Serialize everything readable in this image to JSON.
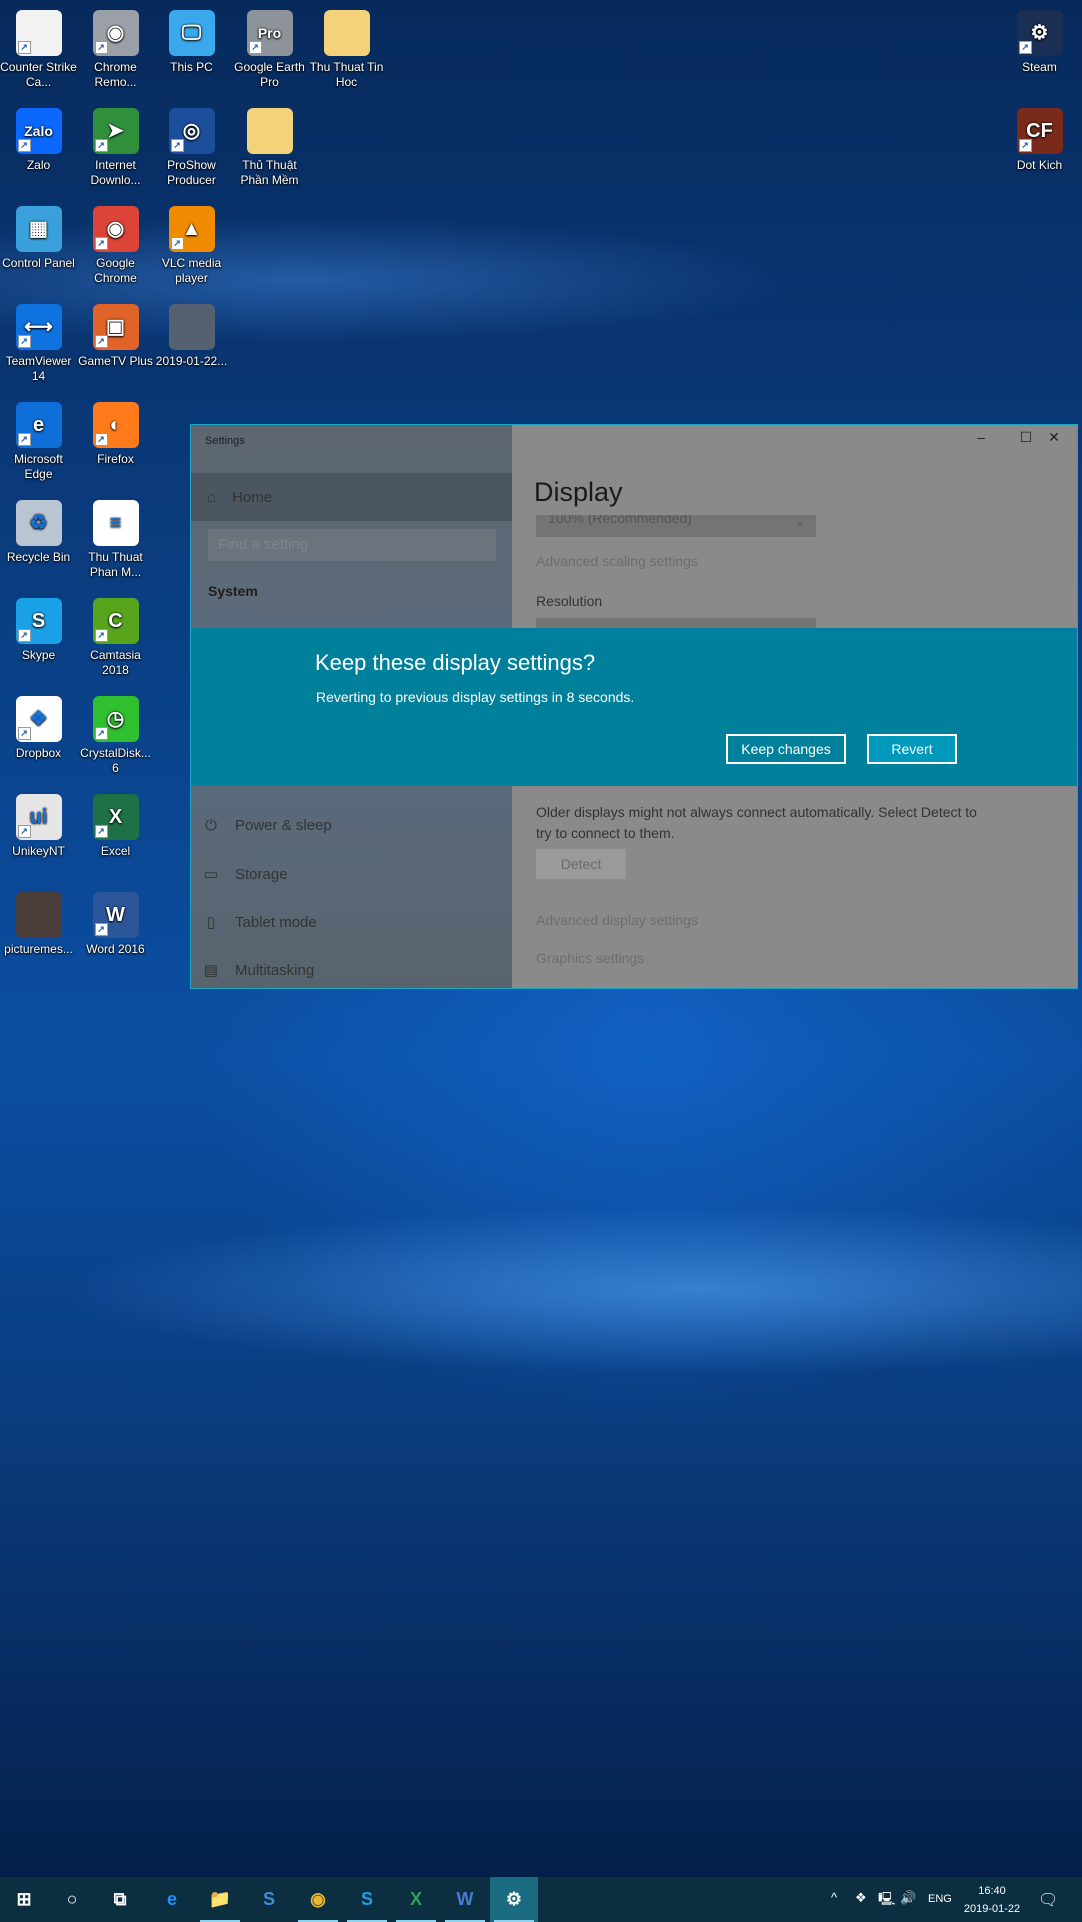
{
  "desktop": {
    "icons": [
      {
        "label": "Counter Strike Ca...",
        "icon": "file-icon",
        "color": "#f2f2f2",
        "glyph": "",
        "shortcut": true
      },
      {
        "label": "Zalo",
        "icon": "zalo-icon",
        "color": "#0a68ff",
        "glyph": "Zalo",
        "shortcut": true
      },
      {
        "label": "Control Panel",
        "icon": "control-panel-icon",
        "color": "#3aa0dc",
        "glyph": "▦",
        "shortcut": false
      },
      {
        "label": "TeamViewer 14",
        "icon": "teamviewer-icon",
        "color": "#0e72e0",
        "glyph": "⟷",
        "shortcut": true
      },
      {
        "label": "Microsoft Edge",
        "icon": "edge-icon",
        "color": "#0f6fd8",
        "glyph": "e",
        "shortcut": true
      },
      {
        "label": "Recycle Bin",
        "icon": "recycle-bin-icon",
        "color": "#b9c6d2",
        "glyph": "♻",
        "shortcut": false
      },
      {
        "label": "Skype",
        "icon": "skype-icon",
        "color": "#1aa1e8",
        "glyph": "S",
        "shortcut": true
      },
      {
        "label": "Dropbox",
        "icon": "dropbox-icon",
        "color": "#ffffff",
        "glyph": "❖",
        "shortcut": true
      },
      {
        "label": "UnikeyNT",
        "icon": "unikey-icon",
        "color": "#e6e6e6",
        "glyph": "ui",
        "shortcut": true
      },
      {
        "label": "picturemes...",
        "icon": "image-thumbnail-icon",
        "color": "#4a3d3a",
        "glyph": "",
        "shortcut": false
      },
      {
        "label": "Chrome Remo...",
        "icon": "chrome-remote-icon",
        "color": "#9aa0a6",
        "glyph": "◉",
        "shortcut": true
      },
      {
        "label": "Internet Downlo...",
        "icon": "idm-icon",
        "color": "#2f8f3a",
        "glyph": "➤",
        "shortcut": true
      },
      {
        "label": "Google Chrome",
        "icon": "chrome-icon",
        "color": "#db4437",
        "glyph": "◉",
        "shortcut": true
      },
      {
        "label": "GameTV Plus",
        "icon": "gametv-icon",
        "color": "#e0632a",
        "glyph": "▣",
        "shortcut": true
      },
      {
        "label": "Firefox",
        "icon": "firefox-icon",
        "color": "#ff7a1a",
        "glyph": "◐",
        "shortcut": true
      },
      {
        "label": "Thu Thuat Phan M...",
        "icon": "document-icon",
        "color": "#ffffff",
        "glyph": "≡",
        "shortcut": false
      },
      {
        "label": "Camtasia 2018",
        "icon": "camtasia-icon",
        "color": "#56a51d",
        "glyph": "C",
        "shortcut": true
      },
      {
        "label": "CrystalDisk... 6",
        "icon": "crystaldisk-icon",
        "color": "#2fbf2f",
        "glyph": "◷",
        "shortcut": true
      },
      {
        "label": "Excel",
        "icon": "excel-icon",
        "color": "#1e7145",
        "glyph": "X",
        "shortcut": true
      },
      {
        "label": "Word 2016",
        "icon": "word-icon",
        "color": "#2b579a",
        "glyph": "W",
        "shortcut": true
      },
      {
        "label": "This PC",
        "icon": "this-pc-icon",
        "color": "#3aa8ec",
        "glyph": "🖵",
        "shortcut": false
      },
      {
        "label": "ProShow Producer",
        "icon": "proshow-icon",
        "color": "#1b4f9c",
        "glyph": "◎",
        "shortcut": true
      },
      {
        "label": "VLC media player",
        "icon": "vlc-icon",
        "color": "#f08a00",
        "glyph": "▲",
        "shortcut": true
      },
      {
        "label": "2019-01-22...",
        "icon": "image-thumbnail-icon",
        "color": "#556070",
        "glyph": "",
        "shortcut": false
      },
      {
        "label": "Google Earth Pro",
        "icon": "google-earth-icon",
        "color": "#8d9399",
        "glyph": "Pro",
        "shortcut": true
      },
      {
        "label": "Thủ Thuật Phần Mềm",
        "icon": "folder-icon",
        "color": "#f3d27a",
        "glyph": "",
        "shortcut": false
      },
      {
        "label": "Thu Thuat Tin Hoc",
        "icon": "folder-icon",
        "color": "#f3d27a",
        "glyph": "",
        "shortcut": false
      },
      {
        "label": "Steam",
        "icon": "steam-icon",
        "color": "#1b2f55",
        "glyph": "⚙",
        "shortcut": true
      },
      {
        "label": "Dot Kich",
        "icon": "dot-kich-icon",
        "color": "#7a2a1a",
        "glyph": "CF",
        "shortcut": true
      }
    ]
  },
  "window": {
    "title": "Settings",
    "controls": {
      "minimize": "–",
      "maximize": "☐",
      "close": "✕"
    },
    "sidebar": {
      "home": "Home",
      "search_placeholder": "Find a setting",
      "section": "System",
      "items": [
        {
          "label": "Power & sleep",
          "icon": "power-icon",
          "glyph": "⏻"
        },
        {
          "label": "Storage",
          "icon": "storage-icon",
          "glyph": "▭"
        },
        {
          "label": "Tablet mode",
          "icon": "tablet-mode-icon",
          "glyph": "▯"
        },
        {
          "label": "Multitasking",
          "icon": "multitasking-icon",
          "glyph": "▤"
        }
      ]
    },
    "main": {
      "title": "Display",
      "scale_value": "100% (Recommended)",
      "advanced_scaling": "Advanced scaling settings",
      "resolution_label": "Resolution",
      "detect_text": "Older displays might not always connect automatically. Select Detect to try to connect to them.",
      "detect_button": "Detect",
      "advanced_display": "Advanced display settings",
      "graphics": "Graphics settings"
    }
  },
  "dialog": {
    "title": "Keep these display settings?",
    "message": "Reverting to previous display settings in  8 seconds.",
    "keep_button": "Keep changes",
    "revert_button": "Revert",
    "color": "#00809b"
  },
  "taskbar": {
    "apps": [
      {
        "name": "start",
        "icon": "windows-start-icon",
        "glyph": "⊞"
      },
      {
        "name": "cortana",
        "icon": "cortana-icon",
        "glyph": "○"
      },
      {
        "name": "task-view",
        "icon": "task-view-icon",
        "glyph": "⧉"
      },
      {
        "name": "edge",
        "icon": "edge-icon",
        "glyph": "e",
        "running": false
      },
      {
        "name": "file-explorer",
        "icon": "file-explorer-icon",
        "glyph": "📁",
        "running": true
      },
      {
        "name": "app-s",
        "icon": "s-app-icon",
        "glyph": "S",
        "running": false
      },
      {
        "name": "chrome",
        "icon": "chrome-icon",
        "glyph": "◉",
        "running": true
      },
      {
        "name": "skype",
        "icon": "skype-icon",
        "glyph": "S",
        "running": true
      },
      {
        "name": "excel",
        "icon": "excel-icon",
        "glyph": "X",
        "running": true
      },
      {
        "name": "word",
        "icon": "word-icon",
        "glyph": "W",
        "running": true
      },
      {
        "name": "settings",
        "icon": "settings-gear-icon",
        "glyph": "⚙",
        "running": true,
        "active": true
      }
    ],
    "tray": {
      "chevron": "^",
      "language": "ENG",
      "time": "16:40",
      "date": "2019-01-22"
    }
  }
}
